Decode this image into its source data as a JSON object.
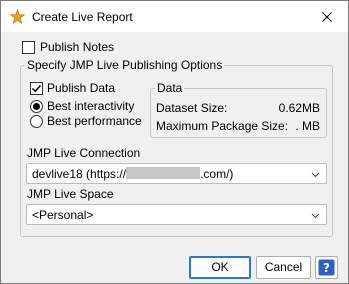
{
  "window": {
    "title": "Create Live Report",
    "close_icon": "close-icon",
    "app_icon": "jmp-star-icon"
  },
  "publish_notes": {
    "label": "Publish Notes",
    "checked": false
  },
  "options_group": {
    "legend": "Specify JMP Live Publishing Options",
    "publish_data": {
      "label": "Publish Data",
      "checked": true
    },
    "radios": [
      {
        "label": "Best interactivity",
        "selected": true
      },
      {
        "label": "Best performance",
        "selected": false
      }
    ],
    "data_box": {
      "legend": "Data",
      "rows": [
        {
          "label": "Dataset Size:",
          "value": "0.62MB"
        },
        {
          "label": "Maximum Package Size:",
          "value": ". MB"
        }
      ]
    },
    "connection": {
      "label": "JMP Live Connection",
      "value_prefix": "devlive18 (https://",
      "value_suffix": ".com/)"
    },
    "space": {
      "label": "JMP Live Space",
      "value": "<Personal>"
    }
  },
  "buttons": {
    "ok": "OK",
    "cancel": "Cancel",
    "help_icon": "help-question-icon"
  },
  "colors": {
    "accent": "#2b78d0",
    "background": "#f0f0f0",
    "help_icon": "#2a62c6"
  }
}
